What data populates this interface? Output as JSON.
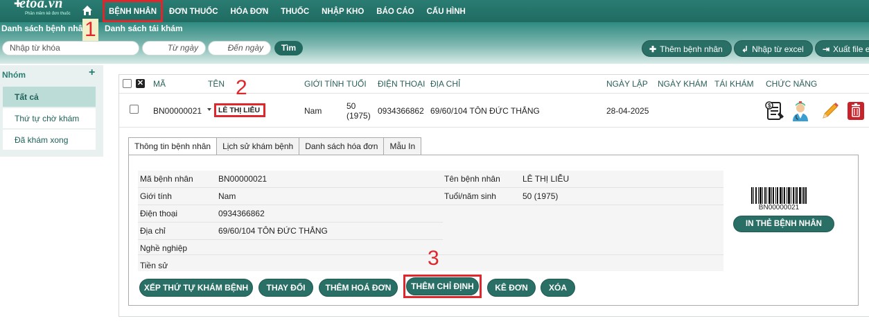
{
  "brand": {
    "logo": "etoa.vn",
    "tagline": "Phần mềm kê đơn thuốc"
  },
  "nav": [
    "BỆNH NHÂN",
    "ĐƠN THUỐC",
    "HÓA ĐƠN",
    "THUỐC",
    "NHẬP KHO",
    "BÁO CÁO",
    "CẤU HÌNH"
  ],
  "subtabs": {
    "patients": "Danh sách bệnh nhân",
    "revisit": "Danh sách tái khám"
  },
  "search": {
    "keyword_placeholder": "Nhập từ khóa",
    "from_placeholder": "Từ ngày",
    "to_placeholder": "Đến ngày",
    "find_label": "Tìm"
  },
  "header_buttons": {
    "add": "Thêm bệnh nhân",
    "import": "Nhập từ excel",
    "export": "Xuất file e"
  },
  "sidebar": {
    "title": "Nhóm",
    "items": [
      "Tất cả",
      "Thứ tự chờ khám",
      "Đã khám xong"
    ]
  },
  "table": {
    "columns": [
      "MÃ",
      "TÊN",
      "GIỚI TÍNH",
      "TUỔI",
      "ĐIỆN THOẠI",
      "ĐỊA CHỈ",
      "NGÀY LẬP",
      "NGÀY KHÁM",
      "TÁI KHÁM",
      "CHỨC NĂNG"
    ],
    "row": {
      "code": "BN00000021",
      "name": "LÊ THỊ LIỄU",
      "gender": "Nam",
      "age": "50",
      "birth": "(1975)",
      "phone": "0934366862",
      "address": "69/60/104 TÔN ĐỨC THẮNG",
      "created": "28-04-2025"
    }
  },
  "markers": [
    "1",
    "2",
    "3"
  ],
  "detail_tabs": [
    "Thông tin bệnh nhân",
    "Lịch sử khám bệnh",
    "Danh sách hóa đơn",
    "Mẫu In"
  ],
  "info": {
    "code_label": "Mã bệnh nhân",
    "code": "BN00000021",
    "name_label": "Tên bệnh nhân",
    "name": "LÊ THỊ LIỄU",
    "gender_label": "Giới tính",
    "gender": "Nam",
    "age_label": "Tuổi/năm sinh",
    "age": "50 (1975)",
    "phone_label": "Điện thoại",
    "phone": "0934366862",
    "address_label": "Địa chỉ",
    "address": "69/60/104 TÔN ĐỨC THẮNG",
    "job_label": "Nghề nghiệp",
    "history_label": "Tiền sử"
  },
  "barcode": {
    "text": "BN00000021",
    "print_label": "IN THẺ BỆNH NHÂN"
  },
  "actions": [
    "XẾP THỨ TỰ KHÁM BỆNH",
    "THAY ĐỔI",
    "THÊM HOÁ ĐƠN",
    "THÊM CHỈ ĐỊNH",
    "KÊ ĐƠN",
    "XÓA"
  ],
  "colors": {
    "primary": "#2a6f66",
    "header": "#2a7c72",
    "highlight": "#e0262b"
  }
}
